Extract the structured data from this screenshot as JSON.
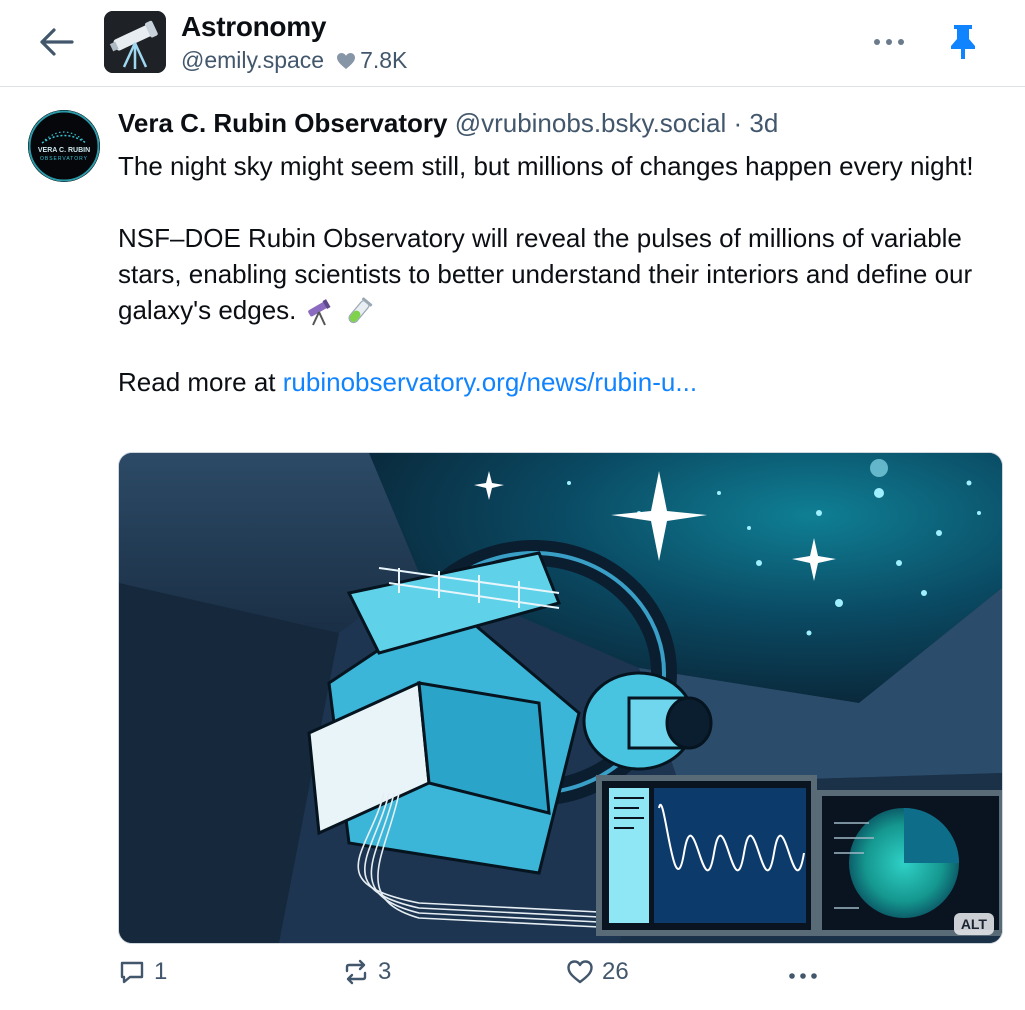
{
  "header": {
    "title": "Astronomy",
    "handle": "@emily.space",
    "likes": "7.8K"
  },
  "post": {
    "author_name": "Vera C. Rubin Observatory",
    "author_handle": "@vrubinobs.bsky.social",
    "separator": "·",
    "time": "3d",
    "avatar_text_line1": "VERA C. RUBIN",
    "avatar_text_line2": "OBSERVATORY",
    "paragraph1": "The night sky might seem still, but millions of changes happen every night!",
    "paragraph2": "NSF–DOE Rubin Observatory will reveal the pulses of millions of variable stars, enabling scientists to better understand their interiors and define our galaxy's edges.",
    "paragraph2_emojis": [
      "telescope-emoji",
      "test-tube-emoji"
    ],
    "read_more_prefix": "Read more at",
    "link_text": "rubinobservatory.org/news/rubin-u...",
    "image_alt_badge": "ALT"
  },
  "actions": {
    "replies": "1",
    "reposts": "3",
    "likes": "26"
  },
  "colors": {
    "link": "#1083fe",
    "pin": "#1083fe",
    "secondary_text": "#42576c"
  }
}
